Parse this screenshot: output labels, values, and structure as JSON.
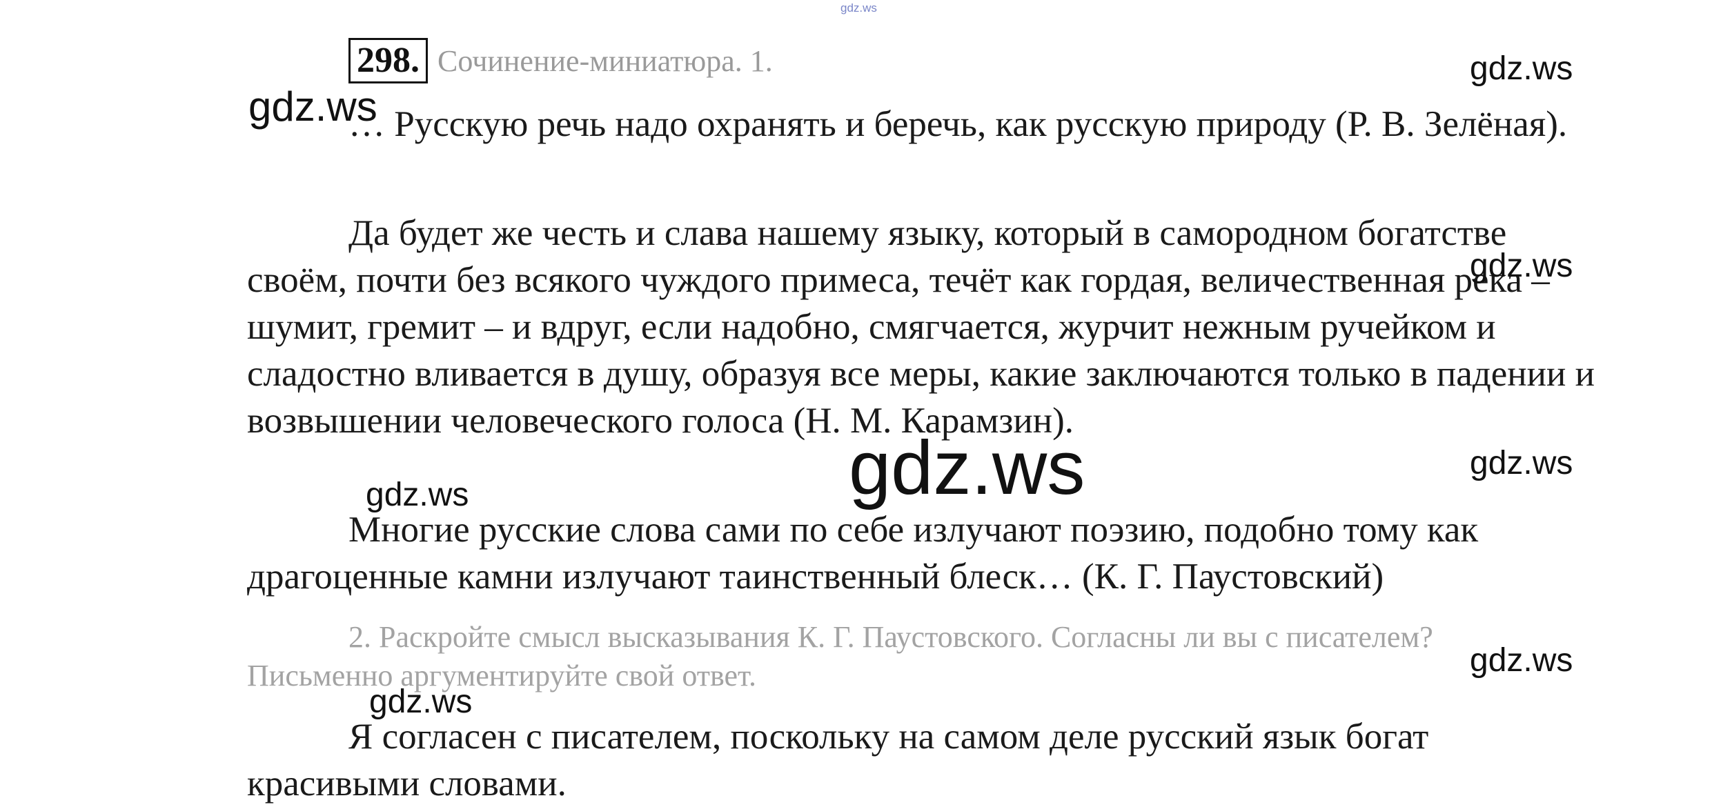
{
  "top_mark": "gdz.ws",
  "header": {
    "number": "298.",
    "title": "Сочинение-миниатюра. 1."
  },
  "paragraphs": {
    "p1": "… Русскую речь надо охранять и беречь, как русскую природу (Р. В. Зелёная).",
    "p2": "Да будет же честь и слава нашему языку, который в самородном богатстве своём, почти без всякого чуждого примеса, течёт как гордая, величественная река – шумит, гремит – и вдруг, если надобно, смягчается, журчит нежным ручейком и сладостно вливается в душу, образуя все меры, какие заключаются только в падении и возвышении человеческого голоса (Н. М. Карамзин).",
    "p3": "Многие русские слова сами по себе излучают поэзию, подобно тому как драгоценные камни излучают таинственный блеск… (К. Г. Паустовский)"
  },
  "task2": "2. Раскройте смысл высказывания К. Г. Паустовского. Согласны ли вы с писателем? Письменно аргументируйте свой ответ.",
  "answer": "Я согласен с писателем, поскольку на самом деле русский язык богат красивыми словами.",
  "watermarks": {
    "w1": "gdz.ws",
    "w2": "gdz.ws",
    "w3": "gdz.ws",
    "w4": "gdz.ws",
    "w5": "gdz.ws",
    "w6": "gdz.ws",
    "w7": "gdz.ws",
    "w8": "gdz.ws",
    "center": "gdz.ws"
  }
}
